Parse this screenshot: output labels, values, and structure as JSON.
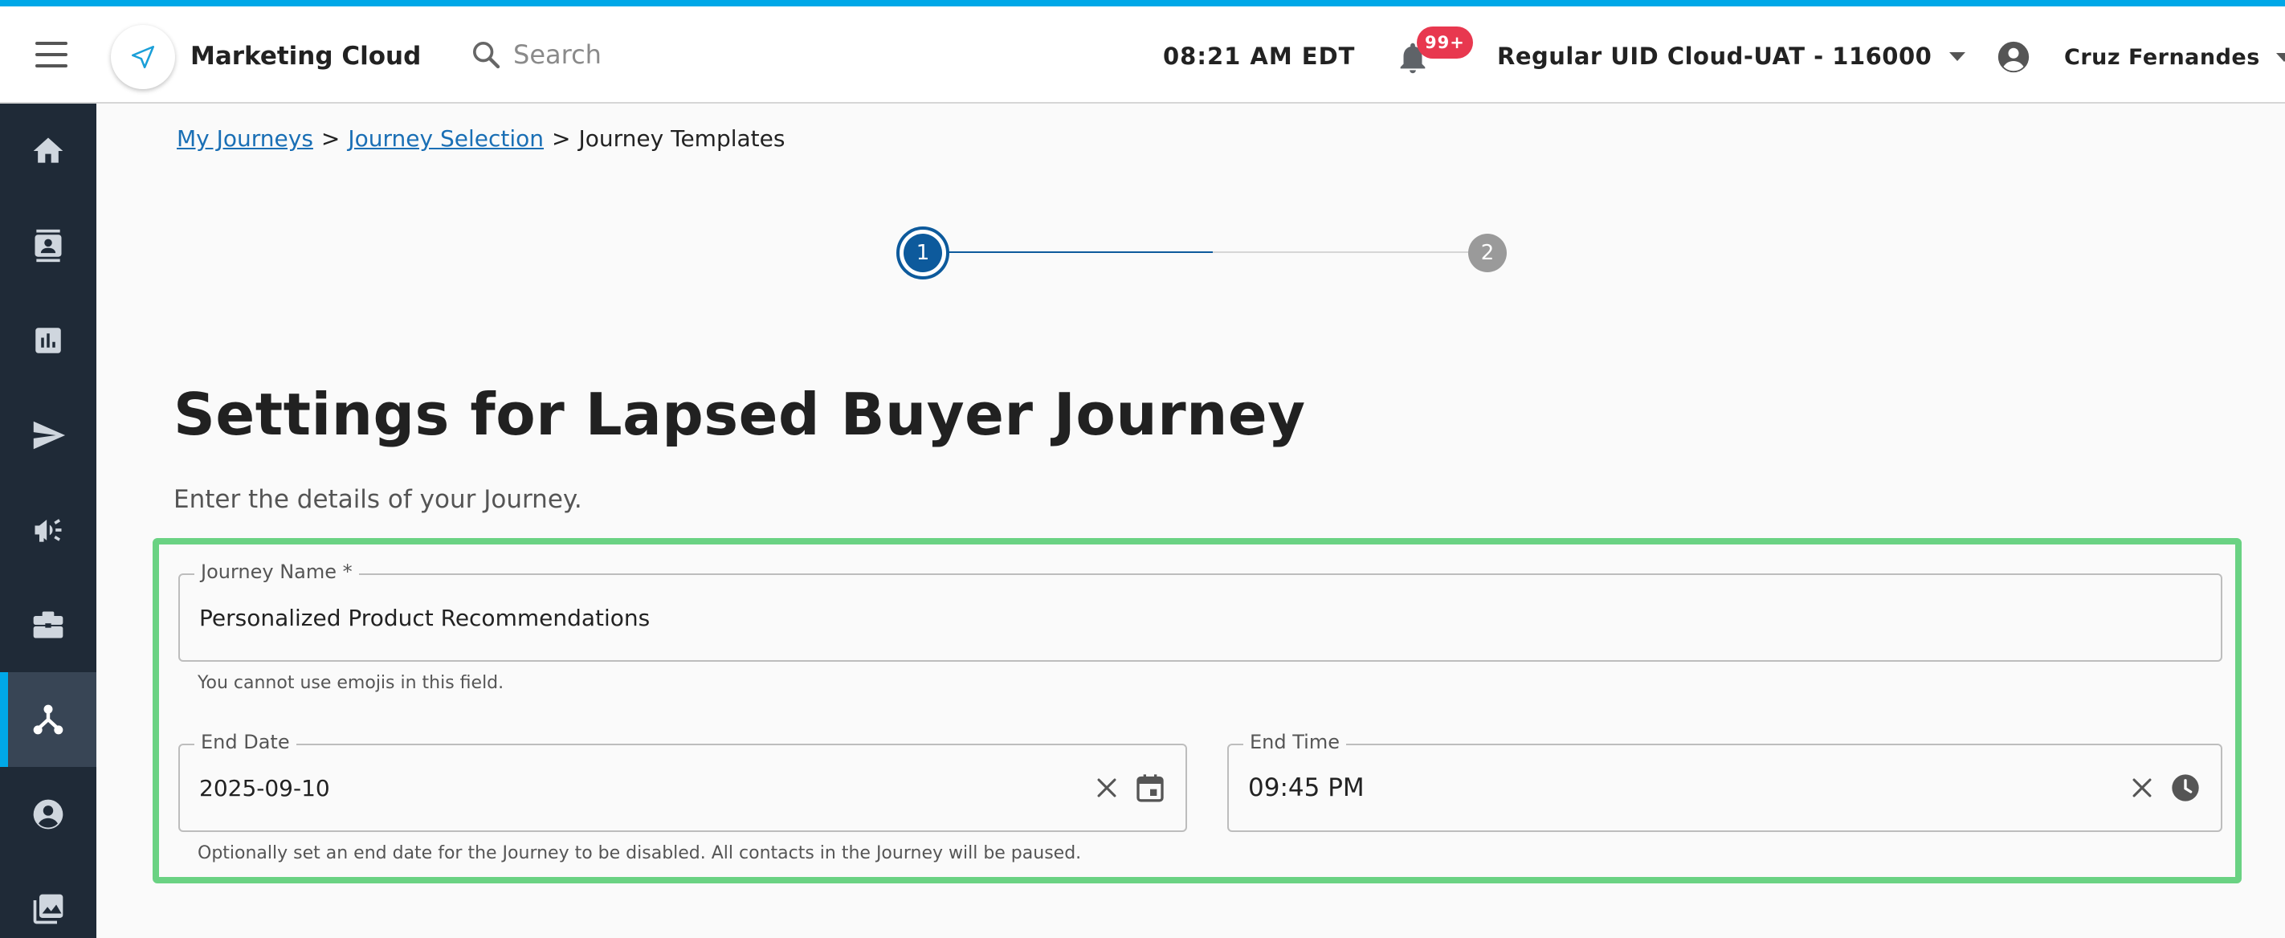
{
  "header": {
    "app_title": "Marketing Cloud",
    "search_placeholder": "Search",
    "time": "08:21 AM EDT",
    "notification_badge": "99+",
    "org_selector": "Regular UID Cloud-UAT - 116000",
    "user_name": "Cruz Fernandes"
  },
  "sidebar": {
    "items": [
      {
        "icon": "home-icon"
      },
      {
        "icon": "contacts-icon"
      },
      {
        "icon": "bar-chart-icon"
      },
      {
        "icon": "send-icon"
      },
      {
        "icon": "megaphone-icon"
      },
      {
        "icon": "briefcase-icon"
      },
      {
        "icon": "journey-icon",
        "active": true
      },
      {
        "icon": "account-circle-icon"
      },
      {
        "icon": "image-library-icon"
      }
    ]
  },
  "breadcrumb": {
    "items": [
      "My Journeys",
      "Journey Selection",
      "Journey Templates"
    ],
    "separator": ">"
  },
  "stepper": {
    "steps": [
      "1",
      "2"
    ],
    "current": 1,
    "progress_fraction": 0.5
  },
  "page": {
    "title": "Settings for Lapsed Buyer Journey",
    "subtitle": "Enter the details of your Journey."
  },
  "form": {
    "journey_name": {
      "label": "Journey Name *",
      "value": "Personalized Product Recommendations",
      "helper": "You cannot use emojis in this field."
    },
    "end_date": {
      "label": "End Date",
      "value": "2025-09-10"
    },
    "end_time": {
      "label": "End Time",
      "value": "09:45 PM"
    },
    "end_helper": "Optionally set an end date for the Journey to be disabled. All contacts in the Journey will be paused."
  },
  "colors": {
    "accent": "#00a8e8",
    "sidebar_bg": "#1f2a37",
    "step_active": "#0d5a9c",
    "highlight_border": "#6ad283",
    "badge": "#e8384f",
    "link": "#1a6fb5"
  }
}
